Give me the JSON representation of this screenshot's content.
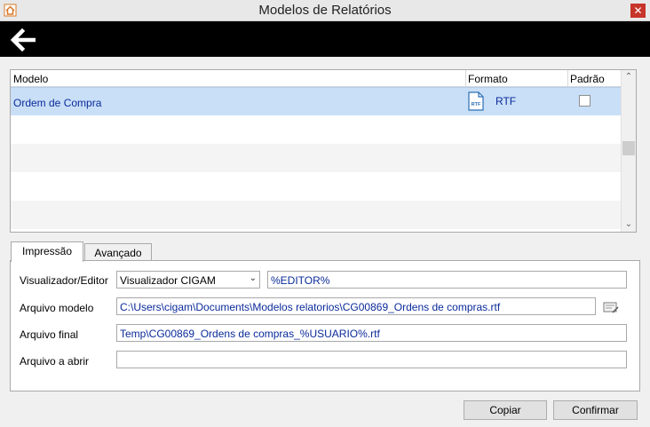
{
  "window": {
    "title": "Modelos de Relatórios",
    "close_label": "✕"
  },
  "grid": {
    "columns": {
      "model": "Modelo",
      "format": "Formato",
      "default": "Padrão"
    },
    "rows": [
      {
        "model": "Ordem de Compra",
        "format": "RTF",
        "default": false,
        "selected": true
      }
    ],
    "format_icon_text": "RTF"
  },
  "tabs": [
    {
      "label": "Impressão",
      "active": true
    },
    {
      "label": "Avançado",
      "active": false
    }
  ],
  "form": {
    "viewer_label": "Visualizador/Editor",
    "viewer_value": "Visualizador CIGAM",
    "viewer_editor_param": "%EDITOR%",
    "model_file_label": "Arquivo modelo",
    "model_file_value": "C:\\Users\\cigam\\Documents\\Modelos relatorios\\CG00869_Ordens de compras.rtf",
    "final_file_label": "Arquivo final",
    "final_file_value": "Temp\\CG00869_Ordens de compras_%USUARIO%.rtf",
    "open_file_label": "Arquivo a abrir",
    "open_file_value": ""
  },
  "buttons": {
    "copy": "Copiar",
    "confirm": "Confirmar"
  }
}
